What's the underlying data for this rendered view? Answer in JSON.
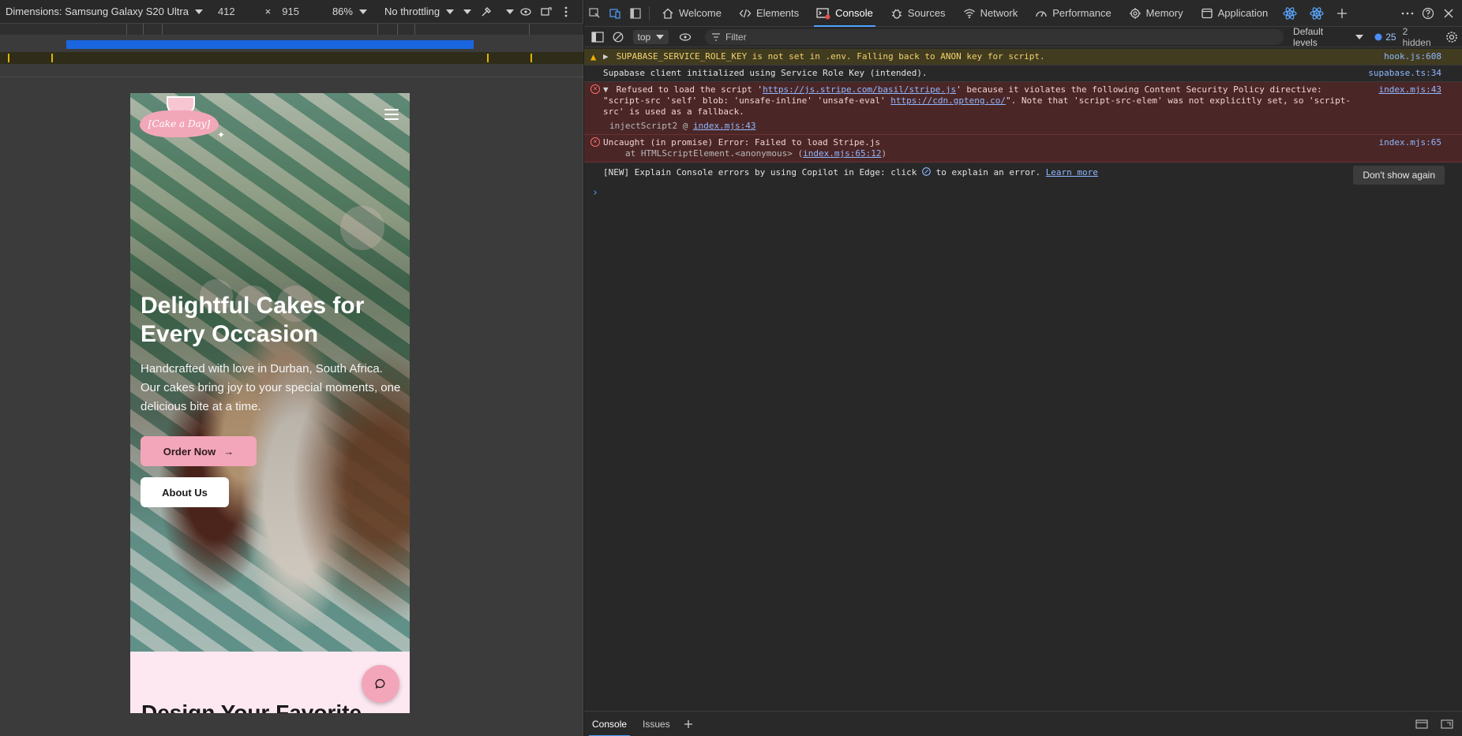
{
  "device_toolbar": {
    "dimensions_label": "Dimensions: Samsung Galaxy S20 Ultra",
    "width": "412",
    "times": "×",
    "height": "915",
    "zoom": "86%",
    "throttling": "No throttling"
  },
  "site": {
    "logo_text": "[Cake a Day]",
    "hero_title": "Delightful Cakes for Every Occasion",
    "hero_subtitle": "Handcrafted with love in Durban, South Africa. Our cakes bring joy to your special moments, one delicious bite at a time.",
    "order_button": "Order Now",
    "order_arrow": "→",
    "about_button": "About Us",
    "below_title": "Design Your Favorite"
  },
  "devtools": {
    "tabs": [
      {
        "label": "Welcome",
        "icon": "home-icon"
      },
      {
        "label": "Elements",
        "icon": "code-icon"
      },
      {
        "label": "Console",
        "icon": "console-icon",
        "active": true
      },
      {
        "label": "Sources",
        "icon": "bug-icon"
      },
      {
        "label": "Network",
        "icon": "wifi-icon"
      },
      {
        "label": "Performance",
        "icon": "gauge-icon"
      },
      {
        "label": "Memory",
        "icon": "chip-icon"
      },
      {
        "label": "Application",
        "icon": "window-icon"
      }
    ],
    "toolbar": {
      "context": "top",
      "filter_placeholder": "Filter",
      "levels": "Default levels",
      "issues_count": "25",
      "hidden": "2 hidden"
    },
    "messages": [
      {
        "type": "warn",
        "text": "SUPABASE_SERVICE_ROLE_KEY is not set in .env. Falling back to ANON key for script.",
        "source": "hook.js:608"
      },
      {
        "type": "info",
        "text": "Supabase client initialized using Service Role Key (intended).",
        "source": "supabase.ts:34"
      },
      {
        "type": "error",
        "text_before": "Refused to load the script '",
        "link1": "https://js.stripe.com/basil/stripe.js",
        "text_mid": "' because it violates the following Content Security Policy directive: \"script-src 'self' blob: 'unsafe-inline' 'unsafe-eval' ",
        "link2": "https://cdn.gpteng.co/",
        "text_after": "\". Note that 'script-src-elem' was not explicitly set, so 'script-src' is used as a fallback.",
        "sub_prefix": "injectScript2 @ ",
        "sub_link": "index.mjs:43",
        "source": "index.mjs:43"
      },
      {
        "type": "error",
        "text": "Uncaught (in promise) Error: Failed to load Stripe.js",
        "sub_prefix": "at HTMLScriptElement.<anonymous> (",
        "sub_link": "index.mjs:65:12",
        "sub_suffix": ")",
        "source": "index.mjs:65"
      }
    ],
    "copilot": {
      "text_before": "[NEW] Explain Console errors by using Copilot in Edge: click",
      "text_after": "to explain an error.",
      "link": "Learn more",
      "button": "Don't show again"
    },
    "drawer": {
      "tabs": [
        "Console",
        "Issues"
      ]
    }
  },
  "colors": {
    "accent_blue": "#4ea1ff",
    "brand_pink": "#f3a6b9",
    "warn_bg": "#413b20",
    "error_bg": "#4b2626"
  }
}
